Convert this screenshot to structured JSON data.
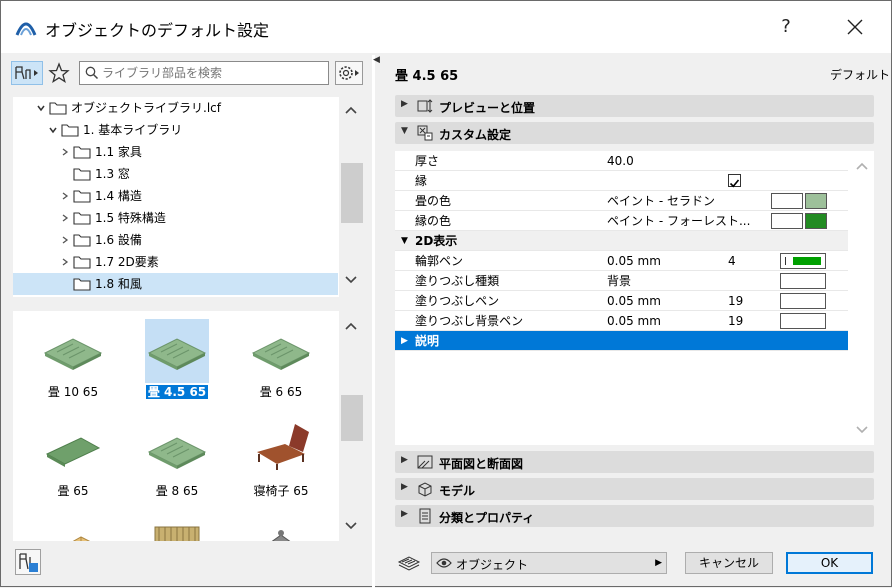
{
  "window": {
    "title": "オブジェクトのデフォルト設定",
    "help": "?",
    "close": "×"
  },
  "search": {
    "placeholder": "ライブラリ部品を検索"
  },
  "tree": [
    {
      "label": "オブジェクトライブラリ.lcf",
      "level": 0,
      "expanded": true
    },
    {
      "label": "1. 基本ライブラリ",
      "level": 1,
      "expanded": true
    },
    {
      "label": "1.1 家具",
      "level": 2,
      "expandable": true
    },
    {
      "label": "1.3 窓",
      "level": 2,
      "expandable": false
    },
    {
      "label": "1.4 構造",
      "level": 2,
      "expandable": true
    },
    {
      "label": "1.5 特殊構造",
      "level": 2,
      "expandable": true
    },
    {
      "label": "1.6 設備",
      "level": 2,
      "expandable": true
    },
    {
      "label": "1.7 2D要素",
      "level": 2,
      "expandable": true
    },
    {
      "label": "1.8 和風",
      "level": 2,
      "expandable": false,
      "selected": true
    }
  ],
  "gallery": [
    {
      "label": "畳 10 65",
      "kind": "tatami"
    },
    {
      "label": "畳 4.5 65",
      "kind": "tatami",
      "selected": true
    },
    {
      "label": "畳 6 65",
      "kind": "tatami"
    },
    {
      "label": "畳 65",
      "kind": "tatami-plain"
    },
    {
      "label": "畳 8 65",
      "kind": "tatami"
    },
    {
      "label": "寝椅子 65",
      "kind": "chair"
    },
    {
      "label": "",
      "kind": "wood"
    },
    {
      "label": "",
      "kind": "fence"
    },
    {
      "label": "",
      "kind": "lantern"
    }
  ],
  "right": {
    "object_name": "畳 4.5 65",
    "default_label": "デフォルト",
    "sections_top": [
      {
        "label": "プレビューと位置",
        "expanded": false,
        "icon": "preview-icon"
      },
      {
        "label": "カスタム設定",
        "expanded": true,
        "icon": "custom-settings-icon"
      }
    ],
    "params": [
      {
        "name": "厚さ",
        "value": "40.0"
      },
      {
        "name": "縁",
        "checkbox": true
      },
      {
        "name": "畳の色",
        "value": "ペイント - セラドン",
        "swatch": "#9dc09a"
      },
      {
        "name": "縁の色",
        "value": "ペイント - フォーレスト...",
        "swatch": "#228b22"
      },
      {
        "name": "2D表示",
        "group": true
      },
      {
        "name": "輪郭ペン",
        "value": "0.05 mm",
        "num": "4",
        "pen": "#00a000"
      },
      {
        "name": "塗りつぶし種類",
        "value": "背景"
      },
      {
        "name": "塗りつぶしペン",
        "value": "0.05 mm",
        "num": "19"
      },
      {
        "name": "塗りつぶし背景ペン",
        "value": "0.05 mm",
        "num": "19"
      },
      {
        "name": "説明",
        "group": true,
        "selected": true
      }
    ],
    "sections_bottom": [
      {
        "label": "平面図と断面図",
        "icon": "floor-plan-icon"
      },
      {
        "label": "モデル",
        "icon": "model-icon"
      },
      {
        "label": "分類とプロパティ",
        "icon": "classification-icon"
      }
    ]
  },
  "footer": {
    "view_label": "オブジェクト",
    "cancel": "キャンセル",
    "ok": "OK"
  },
  "colors": {
    "accent": "#0078d7",
    "selection": "#cce4f7",
    "tatami": "#8fb88b"
  }
}
